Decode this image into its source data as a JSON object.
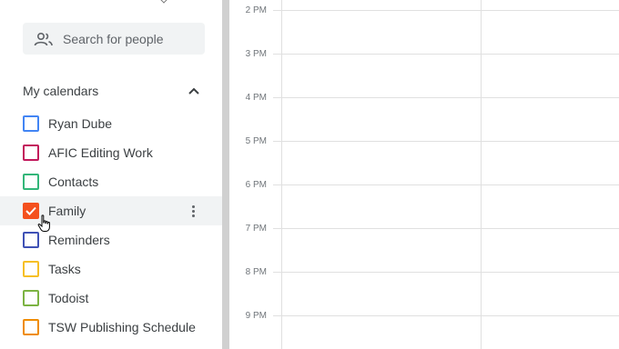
{
  "search": {
    "placeholder": "Search for people"
  },
  "my_calendars": {
    "title": "My calendars",
    "items": [
      {
        "label": "Ryan Dube",
        "color": "#4285f4",
        "checked": false
      },
      {
        "label": "AFIC Editing Work",
        "color": "#c2185b",
        "checked": false
      },
      {
        "label": "Contacts",
        "color": "#33b679",
        "checked": false
      },
      {
        "label": "Family",
        "color": "#f4511e",
        "checked": true
      },
      {
        "label": "Reminders",
        "color": "#3f51b5",
        "checked": false
      },
      {
        "label": "Tasks",
        "color": "#f6bf26",
        "checked": false
      },
      {
        "label": "Todoist",
        "color": "#7cb342",
        "checked": false
      },
      {
        "label": "TSW Publishing Schedule",
        "color": "#ef8c00",
        "checked": false
      }
    ]
  },
  "time_grid": {
    "hours": [
      "2 PM",
      "3 PM",
      "4 PM",
      "5 PM",
      "6 PM",
      "7 PM",
      "8 PM",
      "9 PM"
    ]
  }
}
